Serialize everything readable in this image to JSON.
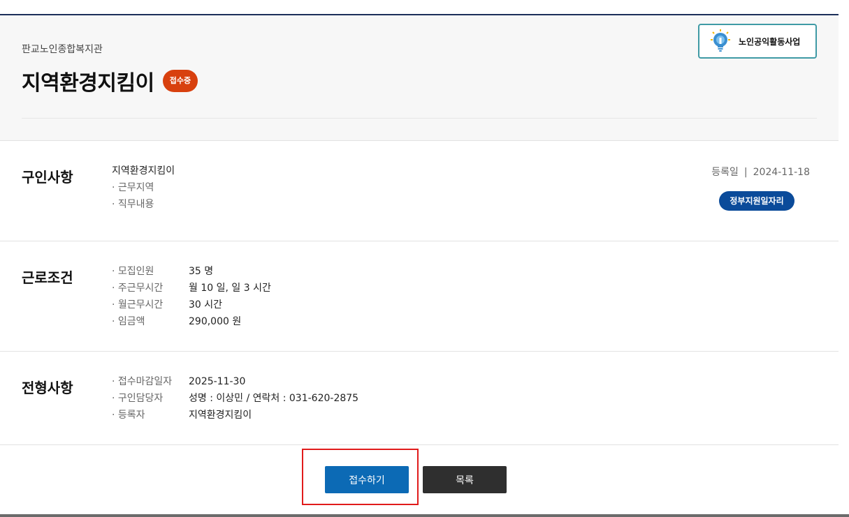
{
  "header": {
    "org": "판교노인종합복지관",
    "title": "지역환경지킴이",
    "status": "접수중",
    "program": "노인공익활동사업"
  },
  "recruit": {
    "heading": "구인사항",
    "job_name": "지역환경지킴이",
    "items": [
      {
        "label": "· 근무지역"
      },
      {
        "label": "· 직무내용"
      }
    ],
    "reg_label": "등록일",
    "reg_sep": "|",
    "reg_date": "2024-11-18",
    "gov_badge": "정부지원일자리"
  },
  "conditions": {
    "heading": "근로조건",
    "rows": [
      {
        "label": "· 모집인원",
        "value": "35 명"
      },
      {
        "label": "· 주근무시간",
        "value": "월 10 일, 일 3 시간"
      },
      {
        "label": "· 월근무시간",
        "value": "30 시간"
      },
      {
        "label": "· 임금액",
        "value": "290,000 원"
      }
    ]
  },
  "selection": {
    "heading": "전형사항",
    "rows": [
      {
        "label": "· 접수마감일자",
        "value": "2025-11-30"
      },
      {
        "label": "· 구인담당자",
        "value": "성명 : 이상민 / 연락처 : 031-620-2875"
      },
      {
        "label": "· 등록자",
        "value": "지역환경지킴이"
      }
    ]
  },
  "actions": {
    "apply_label": "접수하기",
    "list_label": "목록"
  },
  "colors": {
    "status_badge": "#d8400e",
    "gov_badge": "#0b4b9a",
    "apply_button": "#0c6ab5",
    "list_button": "#2f2f2f",
    "highlight": "#e11b1b",
    "program_border": "#3f9aa5"
  },
  "icons": {
    "program": "lightbulb-icon"
  }
}
